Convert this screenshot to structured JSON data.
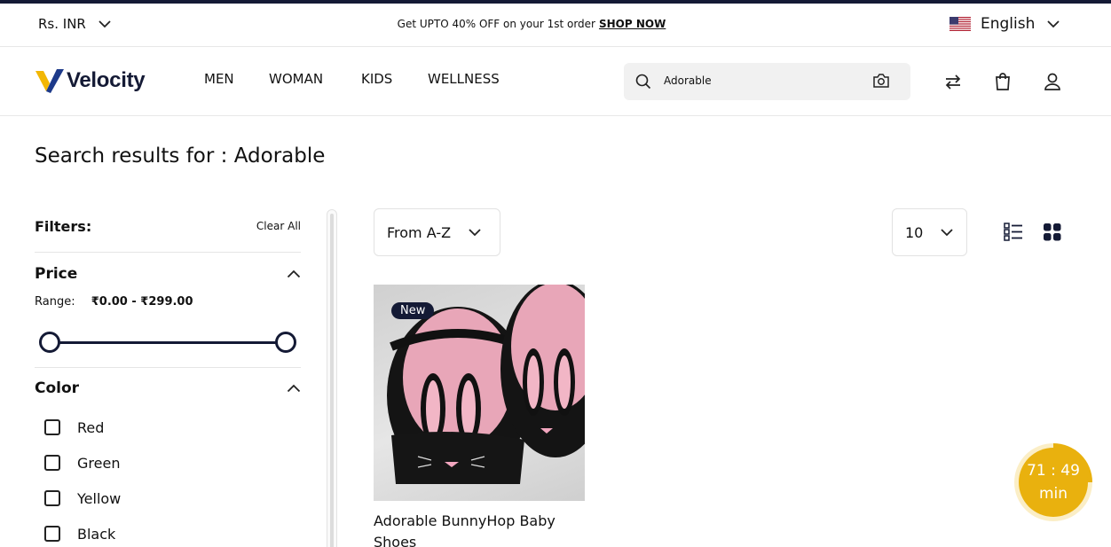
{
  "announcement": {
    "currency": "Rs. INR",
    "promo_text": "Get UPTO 40% OFF on your 1st order",
    "promo_link": "SHOP NOW",
    "language": "English"
  },
  "header": {
    "logo_text": "Velocity",
    "nav": [
      "MEN",
      "WOMAN",
      "KIDS",
      "WELLNESS"
    ],
    "search": {
      "value": "Adorable"
    }
  },
  "page": {
    "title": "Search results for : Adorable"
  },
  "filters": {
    "heading": "Filters:",
    "clear_all": "Clear All",
    "price": {
      "title": "Price",
      "range_label": "Range:",
      "range_value": "₹0.00 - ₹299.00"
    },
    "color": {
      "title": "Color",
      "options": [
        "Red",
        "Green",
        "Yellow",
        "Black"
      ]
    }
  },
  "toolbar": {
    "sort": "From A-Z",
    "per_page": "10"
  },
  "products": [
    {
      "badge": "New",
      "name": "Adorable BunnyHop Baby Shoes"
    }
  ],
  "timer": {
    "time": "71 : 49",
    "unit": "min"
  },
  "colors": {
    "brand_navy": "#141a35",
    "accent_yellow": "#e9b10e"
  }
}
